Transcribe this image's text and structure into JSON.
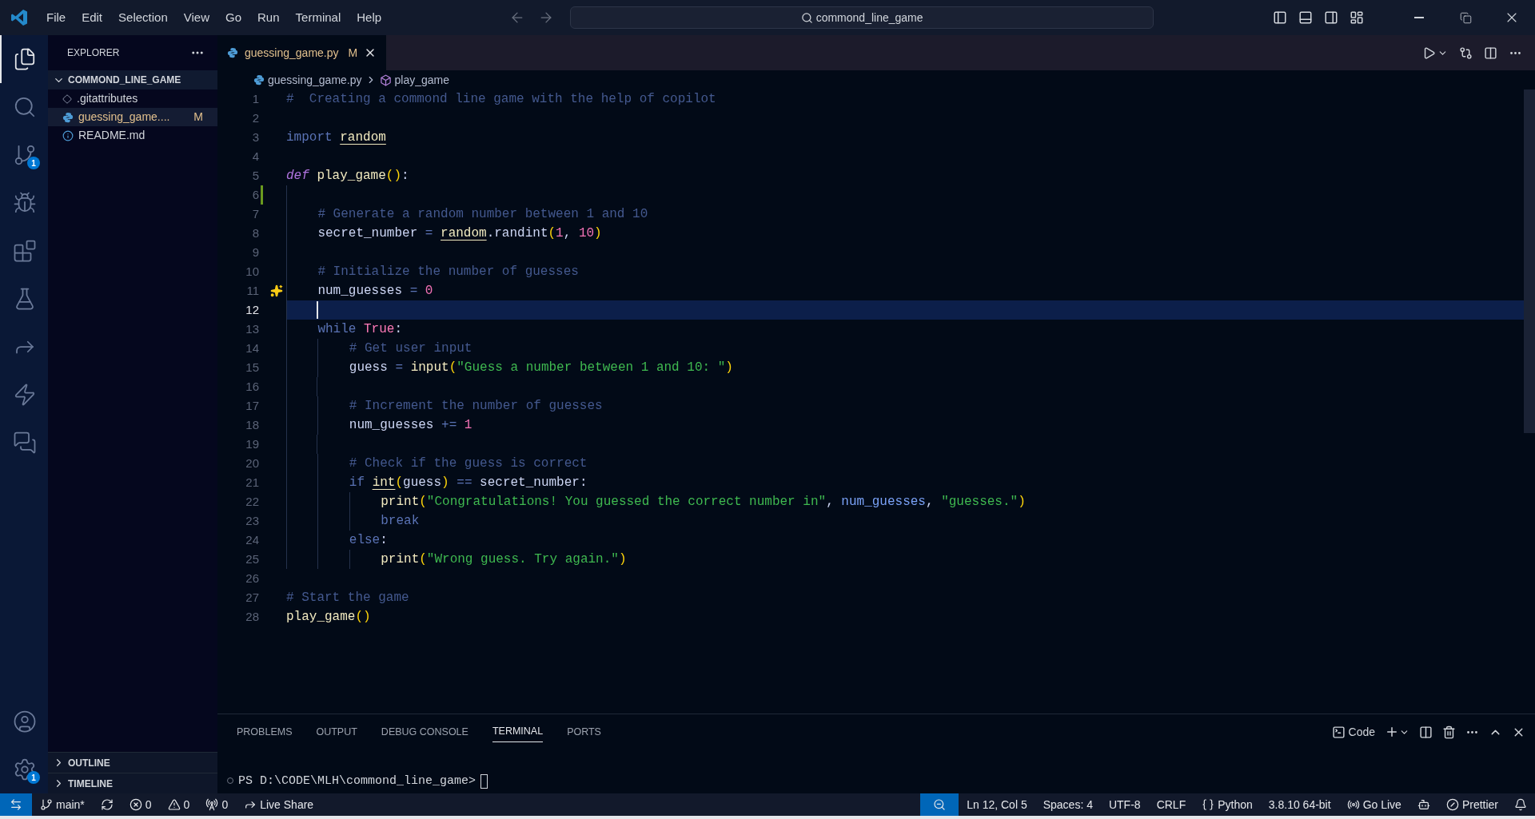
{
  "menu": [
    "File",
    "Edit",
    "Selection",
    "View",
    "Go",
    "Run",
    "Terminal",
    "Help"
  ],
  "command_center": {
    "label": "commond_line_game"
  },
  "activity_bar": {
    "items": [
      {
        "kind": "explorer",
        "selected": true
      },
      {
        "kind": "search",
        "selected": false
      },
      {
        "kind": "source_control",
        "selected": false,
        "badge": "1"
      },
      {
        "kind": "run_debug",
        "selected": false
      },
      {
        "kind": "extensions",
        "selected": false
      },
      {
        "kind": "testing",
        "selected": false
      },
      {
        "kind": "remote",
        "selected": false
      },
      {
        "kind": "thunder",
        "selected": false
      },
      {
        "kind": "chat",
        "selected": false
      }
    ],
    "bottom": [
      {
        "kind": "accounts"
      },
      {
        "kind": "manage",
        "badge": "1"
      }
    ]
  },
  "sidebar": {
    "title": "EXPLORER",
    "folder": {
      "label": "COMMOND_LINE_GAME",
      "expanded": true
    },
    "files": [
      {
        "name": ".gitattributes",
        "kind": "git",
        "selected": false
      },
      {
        "name": "guessing_game....",
        "kind": "python",
        "selected": true,
        "status": "M"
      },
      {
        "name": "README.md",
        "kind": "info",
        "selected": false
      }
    ],
    "sections": [
      {
        "label": "OUTLINE",
        "expanded": false
      },
      {
        "label": "TIMELINE",
        "expanded": false
      }
    ]
  },
  "tabs": [
    {
      "label": "guessing_game.py",
      "status": "M",
      "selected": true
    }
  ],
  "breadcrumb": [
    {
      "label": "guessing_game.py",
      "kind": "python"
    },
    {
      "label": "play_game",
      "kind": "symbol"
    }
  ],
  "editor": {
    "lines": [
      {
        "number": "1",
        "current": false,
        "modified": false,
        "hint": false,
        "tokens": [
          {
            "kind": "comment",
            "text": "#  Creating a commond line game with the help of copilot"
          }
        ]
      },
      {
        "number": "2",
        "current": false,
        "modified": false,
        "hint": false
      },
      {
        "number": "3",
        "current": false,
        "modified": false,
        "hint": false,
        "tokens": [
          {
            "kind": "keyword",
            "text": "import "
          },
          {
            "kind": "module",
            "text": "random"
          }
        ]
      },
      {
        "number": "4",
        "current": false,
        "modified": false,
        "hint": false
      },
      {
        "number": "5",
        "current": false,
        "modified": false,
        "hint": false,
        "tokens": [
          {
            "kind": "def",
            "text": "def "
          },
          {
            "kind": "func",
            "text": "play_game"
          },
          {
            "kind": "paren",
            "text": "()"
          },
          {
            "kind": "plain",
            "text": ":"
          }
        ]
      },
      {
        "number": "6",
        "current": false,
        "modified": true,
        "hint": false
      },
      {
        "number": "7",
        "current": false,
        "modified": false,
        "hint": false,
        "tokens": [
          {
            "kind": "comment",
            "text": "    # Generate a random number between 1 and 10"
          }
        ]
      },
      {
        "number": "8",
        "current": false,
        "modified": false,
        "hint": false,
        "tokens": [
          {
            "kind": "var",
            "text": "    secret_number"
          },
          {
            "kind": "op",
            "text": " = "
          },
          {
            "kind": "module",
            "text": "random"
          },
          {
            "kind": "plain",
            "text": "."
          },
          {
            "kind": "var",
            "text": "randint"
          },
          {
            "kind": "paren",
            "text": "("
          },
          {
            "kind": "number",
            "text": "1"
          },
          {
            "kind": "plain",
            "text": ", "
          },
          {
            "kind": "number",
            "text": "10"
          },
          {
            "kind": "paren",
            "text": ")"
          }
        ]
      },
      {
        "number": "9",
        "current": false,
        "modified": false,
        "hint": false
      },
      {
        "number": "10",
        "current": false,
        "modified": false,
        "hint": false,
        "tokens": [
          {
            "kind": "comment",
            "text": "    # Initialize the number of guesses"
          }
        ]
      },
      {
        "number": "11",
        "current": false,
        "modified": false,
        "hint": true,
        "tokens": [
          {
            "kind": "var",
            "text": "    num_guesses"
          },
          {
            "kind": "op",
            "text": " = "
          },
          {
            "kind": "number",
            "text": "0"
          }
        ]
      },
      {
        "number": "12",
        "current": true,
        "modified": false,
        "hint": false
      },
      {
        "number": "13",
        "current": false,
        "modified": false,
        "hint": false,
        "tokens": [
          {
            "kind": "keyword",
            "text": "    while "
          },
          {
            "kind": "constant",
            "text": "True"
          },
          {
            "kind": "plain",
            "text": ":"
          }
        ]
      },
      {
        "number": "14",
        "current": false,
        "modified": false,
        "hint": false,
        "tokens": [
          {
            "kind": "comment",
            "text": "        # Get user input"
          }
        ]
      },
      {
        "number": "15",
        "current": false,
        "modified": false,
        "hint": false,
        "tokens": [
          {
            "kind": "var",
            "text": "        guess"
          },
          {
            "kind": "op",
            "text": " = "
          },
          {
            "kind": "func",
            "text": "input"
          },
          {
            "kind": "paren",
            "text": "("
          },
          {
            "kind": "string",
            "text": "\"Guess a number between 1 and 10: \""
          },
          {
            "kind": "paren",
            "text": ")"
          }
        ]
      },
      {
        "number": "16",
        "current": false,
        "modified": false,
        "hint": false
      },
      {
        "number": "17",
        "current": false,
        "modified": false,
        "hint": false,
        "tokens": [
          {
            "kind": "comment",
            "text": "        # Increment the number of guesses"
          }
        ]
      },
      {
        "number": "18",
        "current": false,
        "modified": false,
        "hint": false,
        "tokens": [
          {
            "kind": "var",
            "text": "        num_guesses"
          },
          {
            "kind": "op",
            "text": " += "
          },
          {
            "kind": "number",
            "text": "1"
          }
        ]
      },
      {
        "number": "19",
        "current": false,
        "modified": false,
        "hint": false
      },
      {
        "number": "20",
        "current": false,
        "modified": false,
        "hint": false,
        "tokens": [
          {
            "kind": "comment",
            "text": "        # Check if the guess is correct"
          }
        ]
      },
      {
        "number": "21",
        "current": false,
        "modified": false,
        "hint": false,
        "tokens": [
          {
            "kind": "keyword",
            "text": "        if "
          },
          {
            "kind": "builtin",
            "text": "int"
          },
          {
            "kind": "paren",
            "text": "("
          },
          {
            "kind": "var",
            "text": "guess"
          },
          {
            "kind": "paren",
            "text": ")"
          },
          {
            "kind": "op",
            "text": " == "
          },
          {
            "kind": "var",
            "text": "secret_number"
          },
          {
            "kind": "plain",
            "text": ":"
          }
        ]
      },
      {
        "number": "22",
        "current": false,
        "modified": false,
        "hint": false,
        "tokens": [
          {
            "kind": "func",
            "text": "            print"
          },
          {
            "kind": "paren",
            "text": "("
          },
          {
            "kind": "string",
            "text": "\"Congratulations! You guessed the correct number in\""
          },
          {
            "kind": "plain",
            "text": ", "
          },
          {
            "kind": "argument",
            "text": "num_guesses"
          },
          {
            "kind": "plain",
            "text": ", "
          },
          {
            "kind": "string",
            "text": "\"guesses.\""
          },
          {
            "kind": "paren",
            "text": ")"
          }
        ]
      },
      {
        "number": "23",
        "current": false,
        "modified": false,
        "hint": false,
        "tokens": [
          {
            "kind": "keyword",
            "text": "            break"
          }
        ]
      },
      {
        "number": "24",
        "current": false,
        "modified": false,
        "hint": false,
        "tokens": [
          {
            "kind": "keyword",
            "text": "        else"
          },
          {
            "kind": "plain",
            "text": ":"
          }
        ]
      },
      {
        "number": "25",
        "current": false,
        "modified": false,
        "hint": false,
        "tokens": [
          {
            "kind": "func",
            "text": "            print"
          },
          {
            "kind": "paren",
            "text": "("
          },
          {
            "kind": "string",
            "text": "\"Wrong guess. Try again.\""
          },
          {
            "kind": "paren",
            "text": ")"
          }
        ]
      },
      {
        "number": "26",
        "current": false,
        "modified": false,
        "hint": false
      },
      {
        "number": "27",
        "current": false,
        "modified": false,
        "hint": false,
        "tokens": [
          {
            "kind": "comment",
            "text": "# Start the game"
          }
        ]
      },
      {
        "number": "28",
        "current": false,
        "modified": false,
        "hint": false,
        "tokens": [
          {
            "kind": "func",
            "text": "play_game"
          },
          {
            "kind": "paren",
            "text": "()"
          }
        ]
      }
    ]
  },
  "panel": {
    "tabs": [
      {
        "label": "PROBLEMS",
        "selected": false
      },
      {
        "label": "OUTPUT",
        "selected": false
      },
      {
        "label": "DEBUG CONSOLE",
        "selected": false
      },
      {
        "label": "TERMINAL",
        "selected": true
      },
      {
        "label": "PORTS",
        "selected": false
      }
    ],
    "profile": "Code",
    "prompt": "PS D:\\CODE\\MLH\\commond_line_game>"
  },
  "status_bar": {
    "left": [
      {
        "kind": "remote"
      },
      {
        "kind": "branch",
        "label": "main*"
      },
      {
        "kind": "sync"
      },
      {
        "kind": "errors",
        "label": "0"
      },
      {
        "kind": "warnings",
        "label": "0"
      },
      {
        "kind": "ports",
        "label": "0"
      },
      {
        "kind": "live_share",
        "label": "Live Share"
      }
    ],
    "right": [
      {
        "kind": "zoom"
      },
      {
        "kind": "text",
        "label": "Ln 12, Col 5"
      },
      {
        "kind": "text",
        "label": "Spaces: 4"
      },
      {
        "kind": "text",
        "label": "UTF-8"
      },
      {
        "kind": "text",
        "label": "CRLF"
      },
      {
        "kind": "language",
        "label": "Python"
      },
      {
        "kind": "text",
        "label": "3.8.10 64-bit"
      },
      {
        "kind": "go_live",
        "label": "Go Live"
      },
      {
        "kind": "copilot"
      },
      {
        "kind": "prettier",
        "label": "Prettier"
      },
      {
        "kind": "bell"
      }
    ]
  }
}
